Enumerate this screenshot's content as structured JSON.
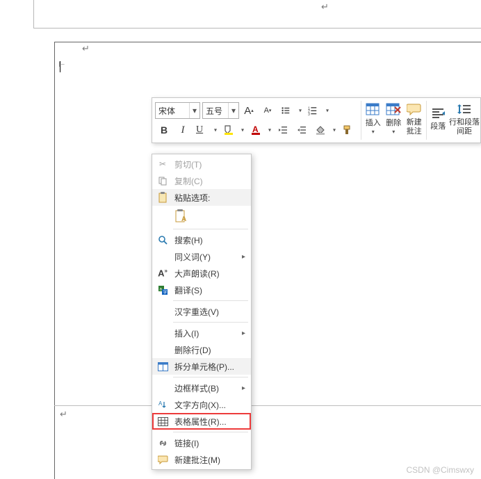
{
  "paragraph_mark": "↵",
  "toolbar": {
    "font_name": "宋体",
    "font_size": "五号",
    "buttons": {
      "grow_font": "A",
      "shrink_font": "A",
      "bold": "B",
      "italic": "I",
      "underline": "U"
    },
    "groups": {
      "insert": "插入",
      "delete": "删除",
      "new_comment": "新建\n批注",
      "paragraph": "段落",
      "line_spacing": "行和段落\n间距"
    }
  },
  "menu": {
    "cut": "剪切(T)",
    "copy": "复制(C)",
    "paste_options": "粘贴选项:",
    "search": "搜索(H)",
    "synonyms": "同义词(Y)",
    "read_aloud": "大声朗读(R)",
    "translate": "翻译(S)",
    "chinese_reselect": "汉字重选(V)",
    "insert": "插入(I)",
    "delete_row": "删除行(D)",
    "split_cells": "拆分单元格(P)...",
    "border_styles": "边框样式(B)",
    "text_direction": "文字方向(X)...",
    "table_properties": "表格属性(R)...",
    "link": "链接(I)",
    "new_comment": "新建批注(M)"
  },
  "submenu_arrow": "▸",
  "watermark": "CSDN @Cimswxy"
}
